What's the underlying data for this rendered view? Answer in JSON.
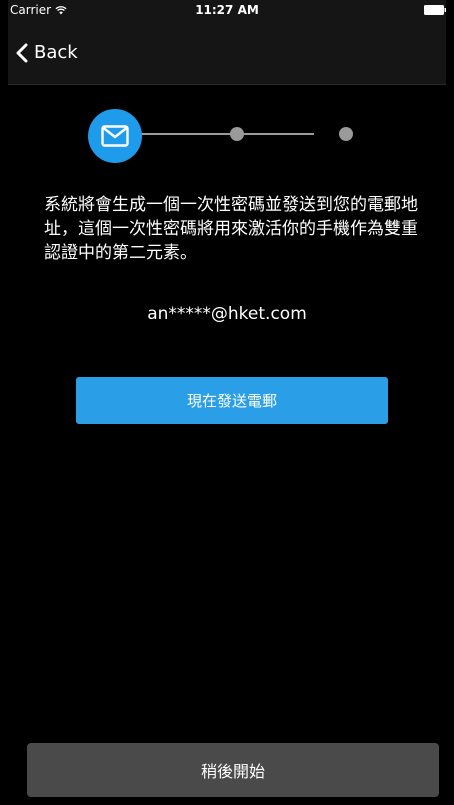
{
  "status_bar": {
    "carrier": "Carrier",
    "time": "11:27 AM"
  },
  "nav": {
    "back_label": "Back"
  },
  "stepper": {
    "current_step": 1,
    "total_steps": 3,
    "active_color": "#1e9bea"
  },
  "main": {
    "description": "系統將會生成一個一次性密碼並發送到您的電郵地址，這個一次性密碼將用來激活你的手機作為雙重認證中的第二元素。",
    "masked_email": "an*****@hket.com",
    "send_button_label": "現在發送電郵"
  },
  "footer": {
    "later_button_label": "稍後開始"
  },
  "colors": {
    "primary": "#2b9ee8",
    "background": "#000000",
    "secondary_button": "#4a4a4a"
  }
}
